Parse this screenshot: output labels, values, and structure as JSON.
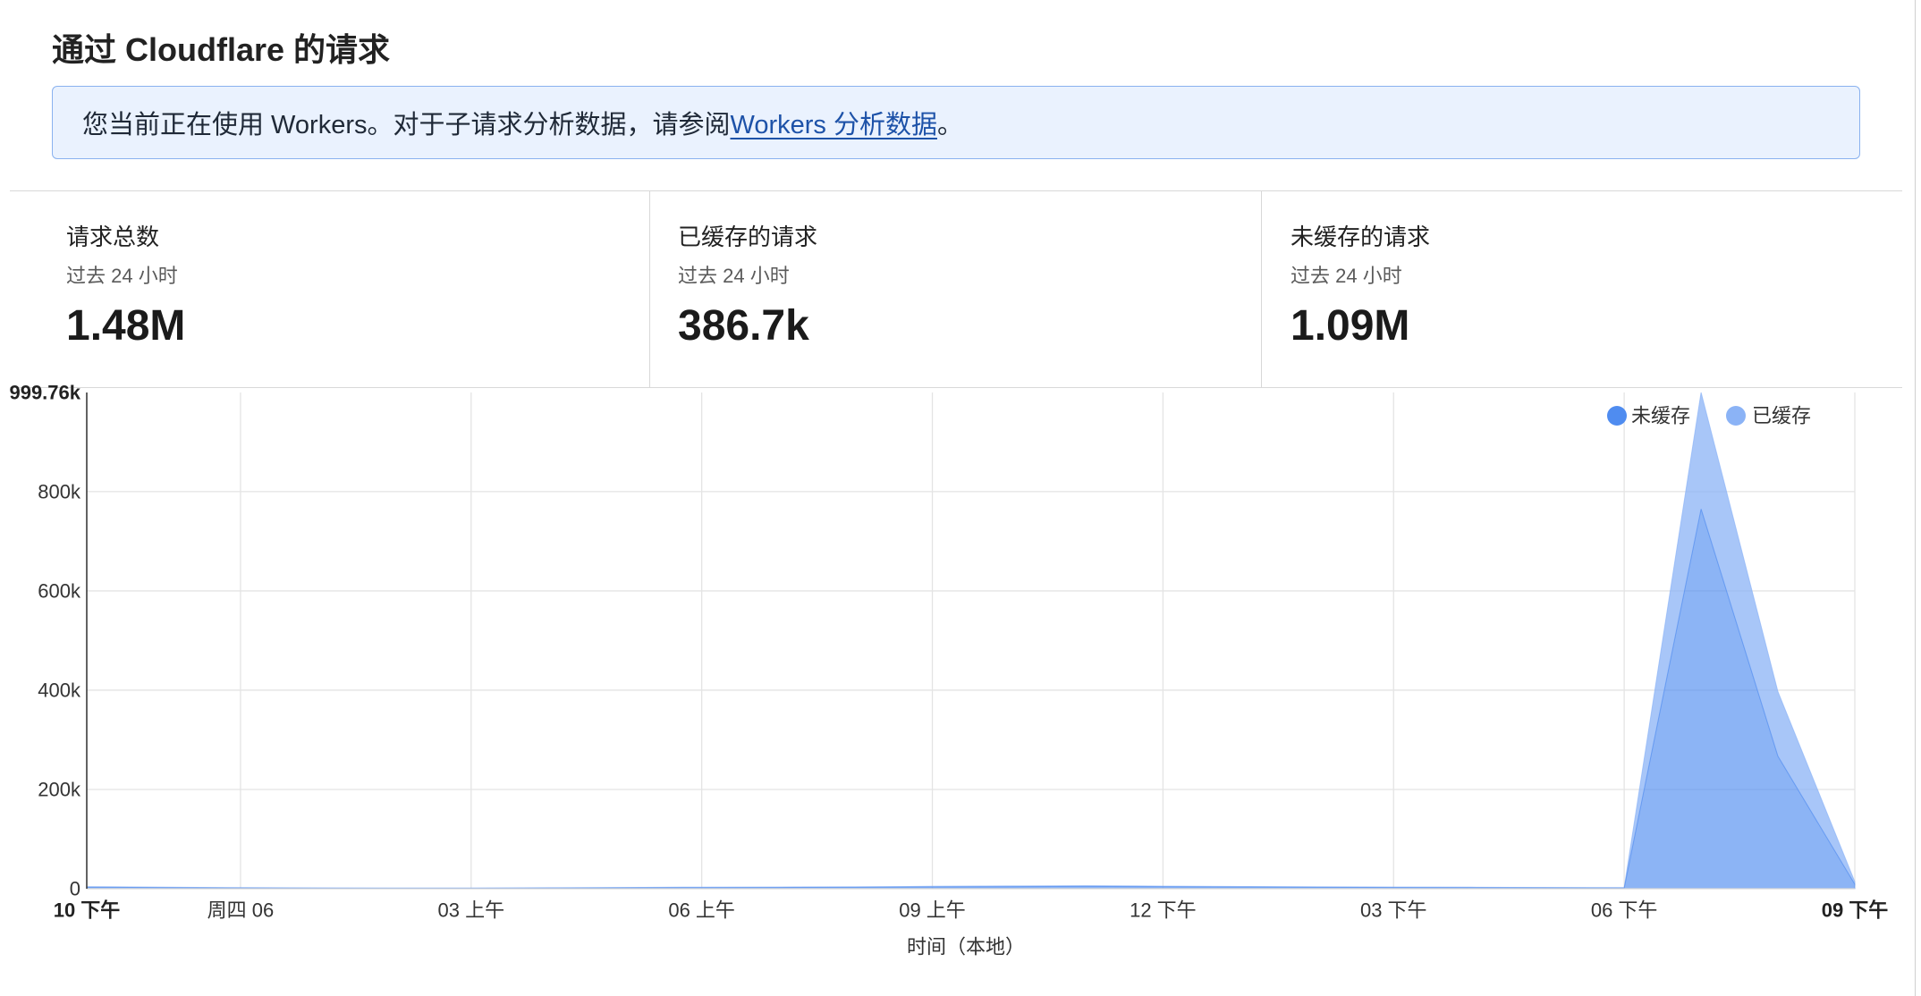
{
  "title": "通过 Cloudflare 的请求",
  "banner": {
    "text_before": "您当前正在使用 Workers。对于子请求分析数据，请参阅 ",
    "link": "Workers 分析数据",
    "text_after": "。"
  },
  "stats": [
    {
      "label": "请求总数",
      "period": "过去 24 小时",
      "value": "1.48M"
    },
    {
      "label": "已缓存的请求",
      "period": "过去 24 小时",
      "value": "386.7k"
    },
    {
      "label": "未缓存的请求",
      "period": "过去 24 小时",
      "value": "1.09M"
    }
  ],
  "colors": {
    "text": "#1f1f1f",
    "muted": "#5a5a5a",
    "link": "#1d52a8",
    "banner_bg": "#eaf2fe",
    "banner_border": "#8ab2ef",
    "divider": "#d8d8d8"
  },
  "chart_data": {
    "type": "area",
    "stacked": true,
    "title": "",
    "xlabel": "时间（本地）",
    "ylabel": "",
    "ylim": [
      0,
      999760
    ],
    "y_ticks": [
      {
        "value": 0,
        "label": "0"
      },
      {
        "value": 200000,
        "label": "200k"
      },
      {
        "value": 400000,
        "label": "400k"
      },
      {
        "value": 600000,
        "label": "600k"
      },
      {
        "value": 800000,
        "label": "800k"
      },
      {
        "value": 999760,
        "label": "999.76k"
      }
    ],
    "x": [
      22,
      23,
      0,
      1,
      2,
      3,
      4,
      5,
      6,
      7,
      8,
      9,
      10,
      11,
      12,
      13,
      14,
      15,
      16,
      17,
      18,
      19,
      20,
      21
    ],
    "x_ticks": [
      {
        "x": 22,
        "label": "10 下午"
      },
      {
        "x": 0,
        "label": "周四 06"
      },
      {
        "x": 3,
        "label": "03 上午"
      },
      {
        "x": 6,
        "label": "06 上午"
      },
      {
        "x": 9,
        "label": "09 上午"
      },
      {
        "x": 12,
        "label": "12 下午"
      },
      {
        "x": 15,
        "label": "03 下午"
      },
      {
        "x": 18,
        "label": "06 下午"
      },
      {
        "x": 21,
        "label": "09 下午"
      }
    ],
    "series": [
      {
        "name": "未缓存",
        "color": "#4f8cf0",
        "values": [
          3200,
          2400,
          1600,
          1200,
          1000,
          1100,
          1500,
          2000,
          2400,
          2600,
          2800,
          3600,
          4200,
          4600,
          4000,
          3400,
          2900,
          2600,
          2300,
          2000,
          1600,
          765000,
          267000,
          9000
        ]
      },
      {
        "name": "已缓存",
        "color": "#8bb3f6",
        "values": [
          900,
          700,
          500,
          400,
          300,
          300,
          400,
          600,
          800,
          900,
          1000,
          1200,
          1400,
          1500,
          1300,
          1100,
          900,
          800,
          700,
          600,
          500,
          234760,
          130000,
          5000
        ]
      }
    ],
    "grid": true,
    "legend": "top-right"
  }
}
